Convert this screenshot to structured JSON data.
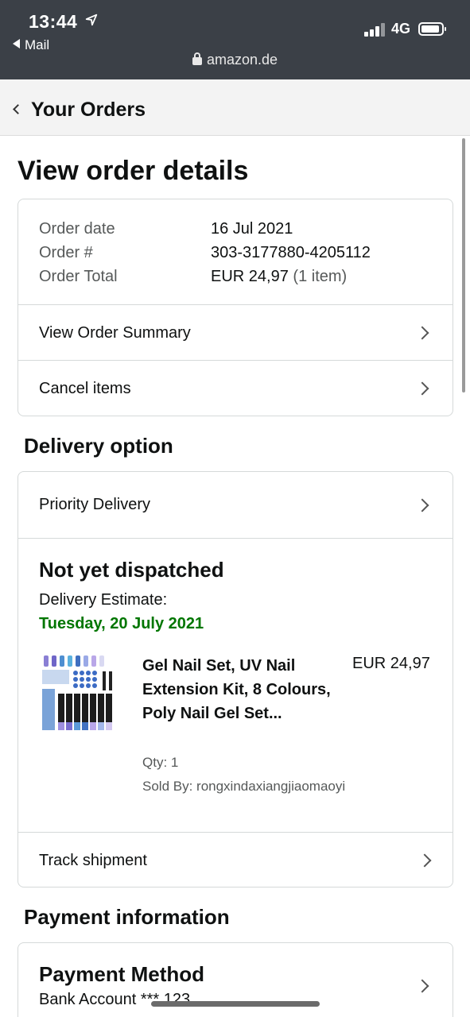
{
  "status_bar": {
    "time": "13:44",
    "back_app": "Mail",
    "network": "4G",
    "url": "amazon.de"
  },
  "nav": {
    "back_label": "Your Orders"
  },
  "page_title": "View order details",
  "order": {
    "date_label": "Order date",
    "date_value": "16 Jul 2021",
    "number_label": "Order #",
    "number_value": "303-3177880-4205112",
    "total_label": "Order Total",
    "total_value": "EUR 24,97",
    "total_items": "(1 item)",
    "summary_link": "View Order Summary",
    "cancel_link": "Cancel items"
  },
  "delivery": {
    "section_title": "Delivery option",
    "option": "Priority Delivery",
    "status": "Not yet dispatched",
    "estimate_label": "Delivery Estimate:",
    "estimate_date": "Tuesday, 20 July 2021",
    "item": {
      "title": "Gel Nail Set, UV Nail Extension Kit, 8 Colours, Poly Nail Gel Set...",
      "price": "EUR 24,97",
      "qty": "Qty: 1",
      "sold_by": "Sold By: rongxindaxiangjiaomaoyi"
    },
    "track_link": "Track shipment"
  },
  "payment": {
    "section_title": "Payment information",
    "method_title": "Payment Method",
    "method_value": "Bank Account *** 123"
  },
  "colors": {
    "status_bg": "#3b4047",
    "nav_bg": "#f3f3f3",
    "estimate_green": "#007600",
    "border": "#d5d9d9"
  }
}
